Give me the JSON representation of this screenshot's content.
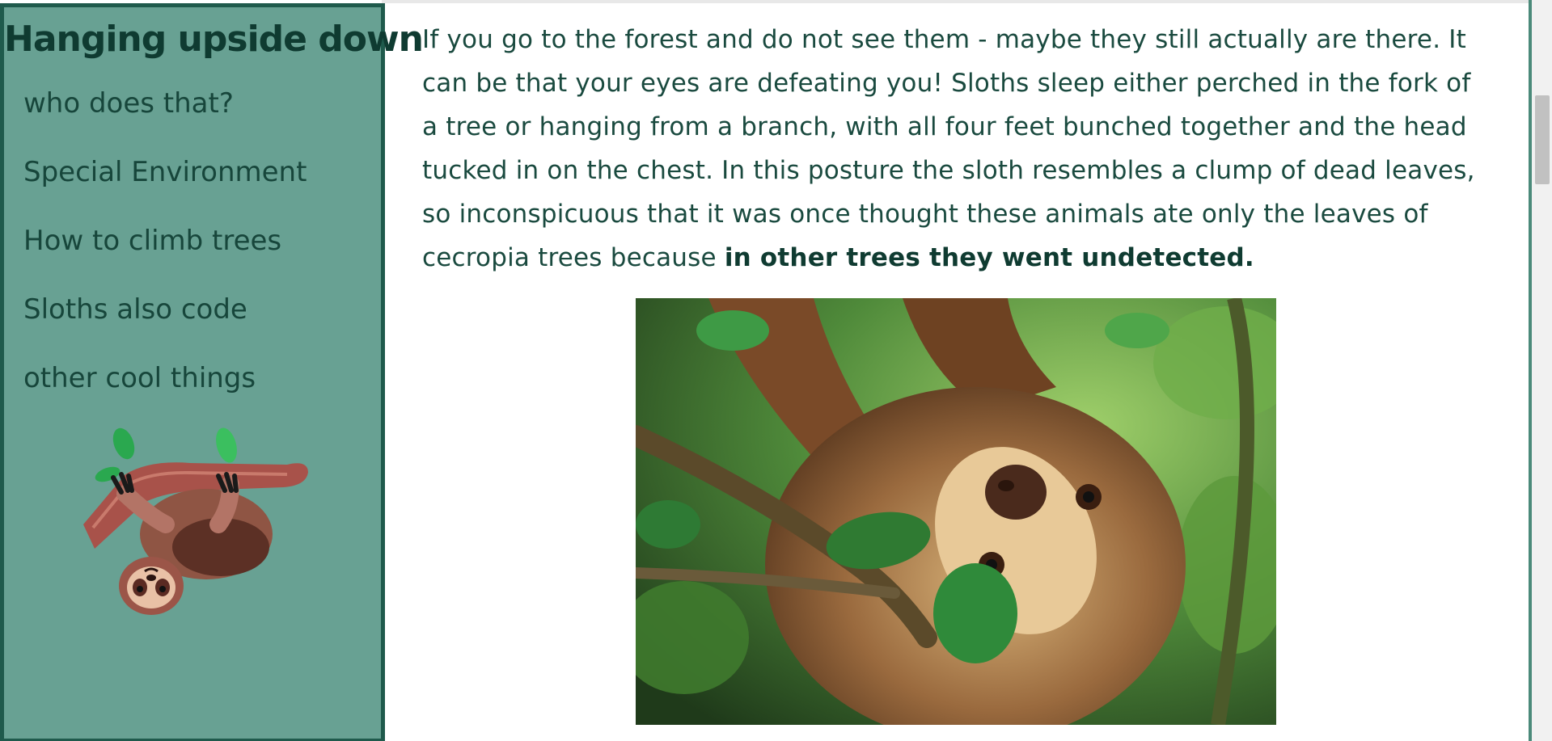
{
  "sidebar": {
    "title": "Hanging upside down",
    "items": [
      {
        "label": "who does that?"
      },
      {
        "label": "Special Environment"
      },
      {
        "label": "How to climb trees"
      },
      {
        "label": "Sloths also code"
      },
      {
        "label": "other cool things"
      }
    ]
  },
  "main": {
    "paragraph_text": "If you go to the forest and do not see them - maybe they still actually are there. It can be that your eyes are defeating you! Sloths sleep either perched in the fork of a tree or hanging from a branch, with all four feet bunched together and the head tucked in on the chest. In this posture the sloth resembles a clump of dead leaves, so inconspicuous that it was once thought these animals ate only the leaves of cecropia trees because ",
    "paragraph_emphasis": "in other trees they went undetected."
  },
  "colors": {
    "sidebar_bg": "#68a193",
    "sidebar_border": "#1f5a4c",
    "text": "#1a4a3f"
  }
}
